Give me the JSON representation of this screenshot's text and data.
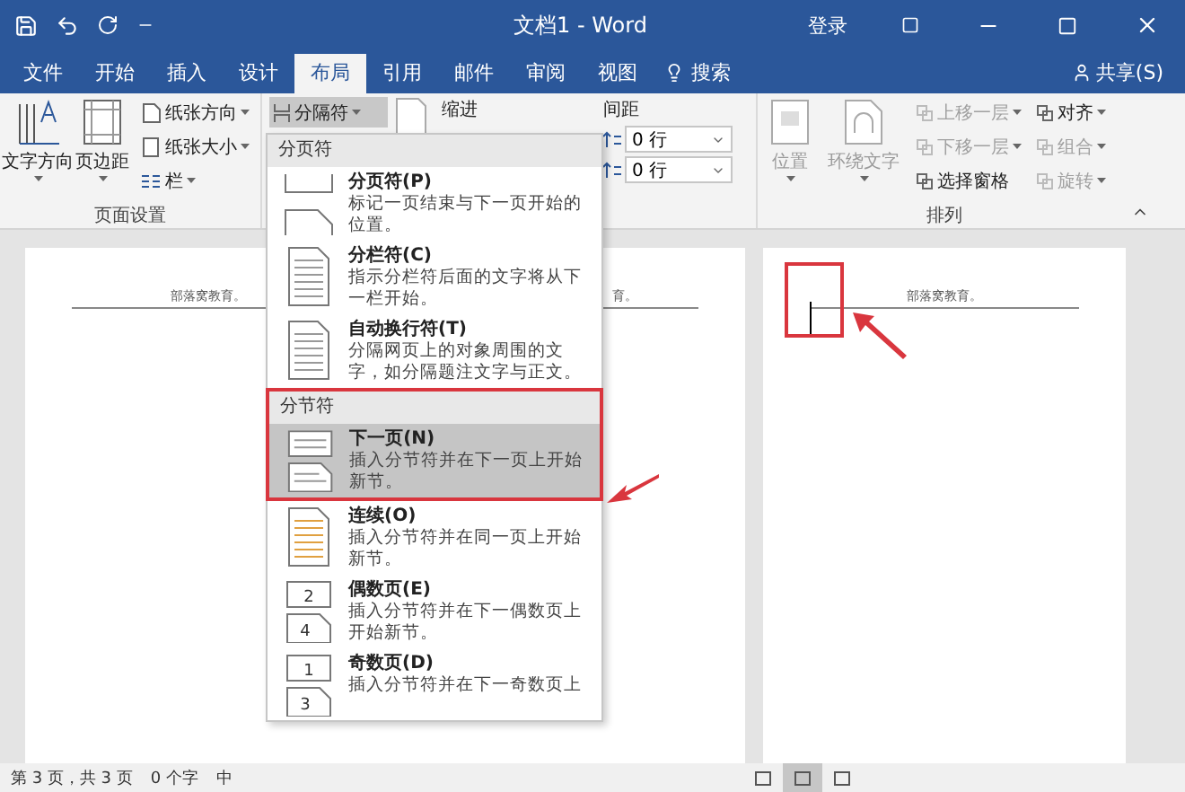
{
  "title_bar": {
    "title": "文档1 - Word",
    "sign_in": "登录"
  },
  "tabs": [
    {
      "label": "文件",
      "selected": false
    },
    {
      "label": "开始",
      "selected": false
    },
    {
      "label": "插入",
      "selected": false
    },
    {
      "label": "设计",
      "selected": false
    },
    {
      "label": "布局",
      "selected": true
    },
    {
      "label": "引用",
      "selected": false
    },
    {
      "label": "邮件",
      "selected": false
    },
    {
      "label": "审阅",
      "selected": false
    },
    {
      "label": "视图",
      "selected": false
    }
  ],
  "search": {
    "label": "搜索"
  },
  "share": {
    "label": "共享(S)"
  },
  "ribbon": {
    "page_setup": {
      "large_buttons": [
        {
          "label": "文字方向",
          "kind": "text_direction"
        },
        {
          "label": "页边距",
          "kind": "margins"
        }
      ],
      "small_buttons": [
        {
          "label": "纸张方向",
          "kind": "orientation"
        },
        {
          "label": "纸张大小",
          "kind": "size"
        },
        {
          "label": "栏",
          "kind": "columns"
        }
      ],
      "label": "页面设置"
    },
    "breaks_button": {
      "label": "分隔符",
      "pressed": true
    },
    "paragraph": {
      "indent_label": "缩进",
      "spacing_label": "间距",
      "spacing_fields": [
        {
          "value": "0 行"
        },
        {
          "value": "0 行"
        }
      ]
    },
    "arrange": {
      "large_buttons": [
        {
          "label": "位置",
          "kind": "position",
          "disabled": true
        },
        {
          "label": "环绕文字",
          "kind": "wrap",
          "disabled": true
        }
      ],
      "small_buttons": [
        {
          "label": "上移一层",
          "disabled": true,
          "dropdown": true
        },
        {
          "label": "下移一层",
          "disabled": true,
          "dropdown": true
        },
        {
          "label": "选择窗格",
          "disabled": false,
          "dropdown": false
        },
        {
          "label": "对齐",
          "disabled": false,
          "dropdown": true
        },
        {
          "label": "组合",
          "disabled": true,
          "dropdown": true
        },
        {
          "label": "旋转",
          "disabled": true,
          "dropdown": true
        }
      ],
      "label": "排列"
    }
  },
  "breaks_menu": {
    "sections": [
      {
        "header": "分页符",
        "items": [
          {
            "kind": "page",
            "title": "分页符(P)",
            "description": "标记一页结束与下一页开始的位置。",
            "selected": false
          },
          {
            "kind": "column",
            "title": "分栏符(C)",
            "description": "指示分栏符后面的文字将从下一栏开始。",
            "selected": false
          },
          {
            "kind": "text_wrapping",
            "title": "自动换行符(T)",
            "description": "分隔网页上的对象周围的文字，如分隔题注文字与正文。",
            "selected": false
          }
        ]
      },
      {
        "header": "分节符",
        "items": [
          {
            "kind": "next_page",
            "title": "下一页(N)",
            "description": "插入分节符并在下一页上开始新节。",
            "selected": true
          },
          {
            "kind": "continuous",
            "title": "连续(O)",
            "description": "插入分节符并在同一页上开始新节。",
            "selected": false
          },
          {
            "kind": "even_page",
            "title": "偶数页(E)",
            "description": "插入分节符并在下一偶数页上开始新节。",
            "icon_numbers": [
              "2",
              "4"
            ],
            "selected": false
          },
          {
            "kind": "odd_page",
            "title": "奇数页(D)",
            "description": "插入分节符并在下一奇数页上",
            "icon_numbers": [
              "1",
              "3"
            ],
            "selected": false
          }
        ]
      }
    ]
  },
  "pages": [
    {
      "header_texts": [
        "部落窝教育。",
        "育。"
      ],
      "cursor": false
    },
    {
      "header_texts": [
        "部落窝教育。"
      ],
      "cursor": true
    }
  ],
  "status_bar": {
    "texts": [
      "第 3 页，共 3 页",
      "0 个字",
      "中"
    ],
    "views": [
      {
        "selected": false
      },
      {
        "selected": true
      },
      {
        "selected": false
      }
    ]
  }
}
